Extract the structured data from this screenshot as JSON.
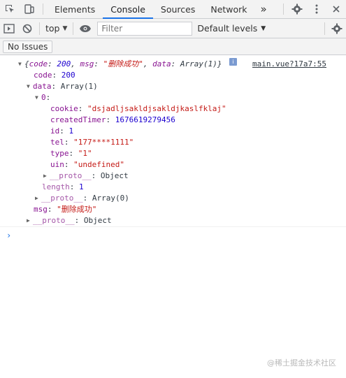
{
  "tabs": {
    "items": [
      "Elements",
      "Console",
      "Sources",
      "Network"
    ],
    "more": "»",
    "active_index": 1
  },
  "toolbar": {
    "context": "top",
    "filter_placeholder": "Filter",
    "levels": "Default levels"
  },
  "issues": {
    "label": "No Issues"
  },
  "console": {
    "summary": {
      "open": "{",
      "code_key": "code",
      "code_val": "200",
      "msg_key": "msg",
      "msg_val": "\"删除成功\"",
      "data_key": "data",
      "data_val": "Array(1)",
      "close": "}"
    },
    "source": "main.vue?17a7:55",
    "info_badge": "i",
    "rows": {
      "code": {
        "key": "code",
        "value": "200"
      },
      "data": {
        "key": "data",
        "value": "Array(1)"
      },
      "index0": {
        "key": "0"
      },
      "cookie": {
        "key": "cookie",
        "value": "\"dsjadljsakldjsakldjkaslfklaj\""
      },
      "createdTimer": {
        "key": "createdTimer",
        "value": "1676619279456"
      },
      "id": {
        "key": "id",
        "value": "1"
      },
      "tel": {
        "key": "tel",
        "value": "\"177****1111\""
      },
      "type": {
        "key": "type",
        "value": "\"1\""
      },
      "uin": {
        "key": "uin",
        "value": "\"undefined\""
      },
      "proto_obj_inner": {
        "key": "__proto__",
        "value": "Object"
      },
      "length": {
        "key": "length",
        "value": "1"
      },
      "proto_array": {
        "key": "__proto__",
        "value": "Array(0)"
      },
      "msg": {
        "key": "msg",
        "value": "\"删除成功\""
      },
      "proto_obj_outer": {
        "key": "__proto__",
        "value": "Object"
      }
    },
    "prompt": "›"
  },
  "watermark": "@稀土掘金技术社区"
}
